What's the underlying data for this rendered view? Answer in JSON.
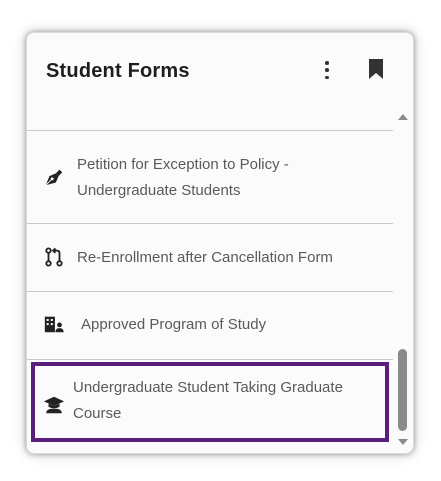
{
  "panel": {
    "title": "Student Forms",
    "more_icon": "kebab-vertical-icon",
    "bookmark_icon": "bookmark-icon"
  },
  "forms": [
    {
      "label": "Petition for Exception to Policy - Undergraduate Students",
      "icon": "pen-nib-icon",
      "selected": false
    },
    {
      "label": "Re-Enrollment after Cancellation Form",
      "icon": "git-pull-request-icon",
      "selected": false
    },
    {
      "label": "Approved Program of Study",
      "icon": "building-person-icon",
      "selected": false
    },
    {
      "label": "Undergraduate Student Taking Graduate Course",
      "icon": "graduate-icon",
      "selected": true
    }
  ],
  "colors": {
    "selection_border": "#5b1e7a",
    "text": "#5a5a5a",
    "title": "#1e1e1e",
    "scroll_thumb": "#8a8a8a"
  }
}
